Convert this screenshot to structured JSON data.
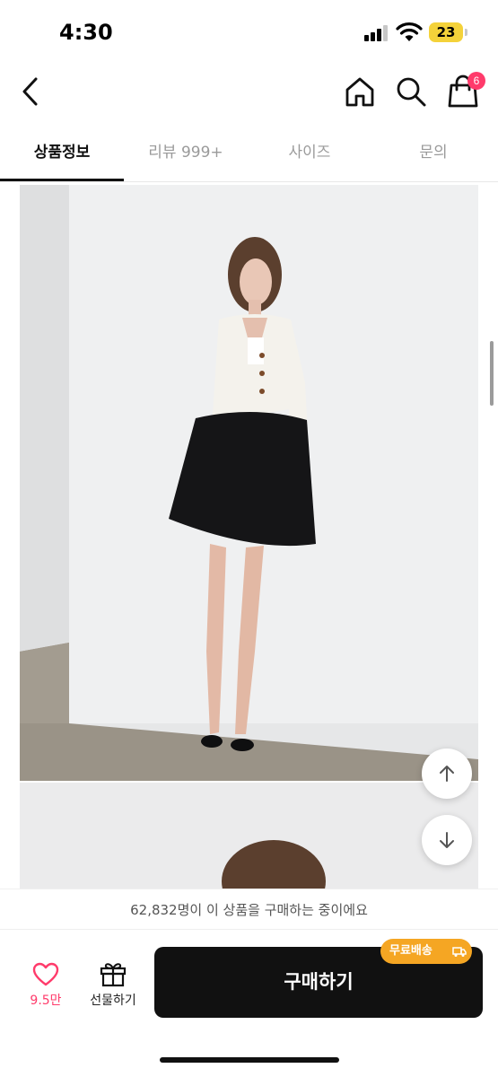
{
  "status_bar": {
    "time": "4:30",
    "battery": "23"
  },
  "nav": {
    "cart_count": "6"
  },
  "tabs": [
    {
      "label": "상품정보",
      "active": true
    },
    {
      "label": "리뷰 999+",
      "active": false
    },
    {
      "label": "사이즈",
      "active": false
    },
    {
      "label": "문의",
      "active": false
    }
  ],
  "banner": {
    "buyers_text": "62,832명이 이 상품을 구매하는 중이에요"
  },
  "actions": {
    "like_count": "9.5만",
    "gift_label": "선물하기",
    "buy_label": "구매하기",
    "free_shipping_label": "무료배송"
  },
  "colors": {
    "accent_pink": "#ff3b6b",
    "shipping_badge": "#f5a623",
    "buy_button": "#111111"
  }
}
